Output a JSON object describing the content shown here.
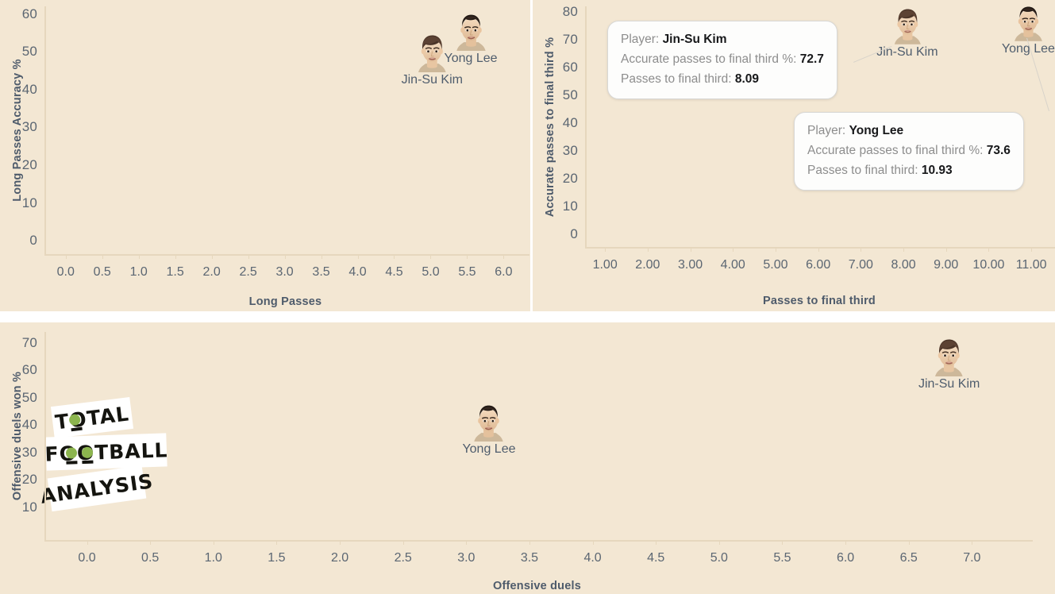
{
  "theme": {
    "panel_bg": "#f3e7d3",
    "page_bg": "#ffffff",
    "axis_text": "#5b6672",
    "axis_title": "#4e5b6b",
    "tooltip_bg": "#fdfdfc",
    "tooltip_border": "#d8d8d6",
    "tooltip_label": "#8d8d8d",
    "tooltip_value": "#17181a",
    "watermark_accent": "#8cb54e"
  },
  "watermark": {
    "line1": "TOTAL",
    "line2": "FOOTBALL",
    "line3": "ANALYSIS"
  },
  "chart_data": [
    {
      "id": "long-passes",
      "type": "scatter",
      "title": "",
      "xlabel": "Long Passes",
      "ylabel": "Long Passes Accuracy %",
      "xlim": [
        -0.28,
        6.3
      ],
      "ylim": [
        -3.5,
        62
      ],
      "xticks": [
        "0.0",
        "0.5",
        "1.0",
        "1.5",
        "2.0",
        "2.5",
        "3.0",
        "3.5",
        "4.0",
        "4.5",
        "5.0",
        "5.5",
        "6.0"
      ],
      "xtick_values": [
        0,
        0.5,
        1.0,
        1.5,
        2.0,
        2.5,
        3.0,
        3.5,
        4.0,
        4.5,
        5.0,
        5.5,
        6.0
      ],
      "yticks": [
        "0",
        "10",
        "20",
        "30",
        "40",
        "50",
        "60"
      ],
      "ytick_values": [
        0,
        10,
        20,
        30,
        40,
        50,
        60
      ],
      "grid": false,
      "points": [
        {
          "name": "Jin-Su Kim",
          "x": 5.02,
          "y": 48.0,
          "face": "jin-su-kim",
          "label_pos": "below"
        },
        {
          "name": "Yong Lee",
          "x": 5.55,
          "y": 53.5,
          "face": "yong-lee",
          "label_pos": "below"
        }
      ]
    },
    {
      "id": "passes-final-third",
      "type": "scatter",
      "title": "",
      "xlabel": "Passes to final third",
      "ylabel": "Accurate passes to final third %",
      "xlim": [
        0.55,
        11.5
      ],
      "ylim": [
        -4.5,
        82
      ],
      "xticks": [
        "1.00",
        "2.00",
        "3.00",
        "4.00",
        "5.00",
        "6.00",
        "7.00",
        "8.00",
        "9.00",
        "10.00",
        "11.00"
      ],
      "xtick_values": [
        1,
        2,
        3,
        4,
        5,
        6,
        7,
        8,
        9,
        10,
        11
      ],
      "yticks": [
        "0",
        "10",
        "20",
        "30",
        "40",
        "50",
        "60",
        "70",
        "80"
      ],
      "ytick_values": [
        0,
        10,
        20,
        30,
        40,
        50,
        60,
        70,
        80
      ],
      "grid": false,
      "points": [
        {
          "name": "Jin-Su Kim",
          "x": 8.09,
          "y": 72.7,
          "face": "jin-su-kim",
          "label_pos": "below"
        },
        {
          "name": "Yong Lee",
          "x": 10.93,
          "y": 73.6,
          "face": "yong-lee",
          "label_pos": "below"
        }
      ],
      "tooltips": [
        {
          "id": "tooltip-jin-su-kim",
          "rows": [
            {
              "label": "Player: ",
              "value": "Jin-Su Kim"
            },
            {
              "label": "Accurate passes to final third %: ",
              "value": "72.7"
            },
            {
              "label": "Passes to final third: ",
              "value": "8.09"
            }
          ]
        },
        {
          "id": "tooltip-yong-lee",
          "rows": [
            {
              "label": "Player: ",
              "value": "Yong Lee"
            },
            {
              "label": "Accurate passes to final third %: ",
              "value": "73.6"
            },
            {
              "label": "Passes to final third: ",
              "value": "10.93"
            }
          ]
        }
      ]
    },
    {
      "id": "offensive-duels",
      "type": "scatter",
      "title": "",
      "xlabel": "Offensive duels",
      "ylabel": "Offensive duels won %",
      "xlim": [
        -0.33,
        7.45
      ],
      "ylim": [
        -2,
        74
      ],
      "xticks": [
        "0.0",
        "0.5",
        "1.0",
        "1.5",
        "2.0",
        "2.5",
        "3.0",
        "3.5",
        "4.0",
        "4.5",
        "5.0",
        "5.5",
        "6.0",
        "6.5",
        "7.0"
      ],
      "xtick_values": [
        0,
        0.5,
        1.0,
        1.5,
        2.0,
        2.5,
        3.0,
        3.5,
        4.0,
        4.5,
        5.0,
        5.5,
        6.0,
        6.5,
        7.0
      ],
      "yticks": [
        "10",
        "20",
        "30",
        "40",
        "50",
        "60",
        "70"
      ],
      "ytick_values": [
        10,
        20,
        30,
        40,
        50,
        60,
        70
      ],
      "grid": false,
      "points": [
        {
          "name": "Yong Lee",
          "x": 3.18,
          "y": 38.5,
          "face": "yong-lee",
          "label_pos": "below"
        },
        {
          "name": "Jin-Su Kim",
          "x": 6.82,
          "y": 62.5,
          "face": "jin-su-kim",
          "label_pos": "below"
        }
      ]
    }
  ]
}
